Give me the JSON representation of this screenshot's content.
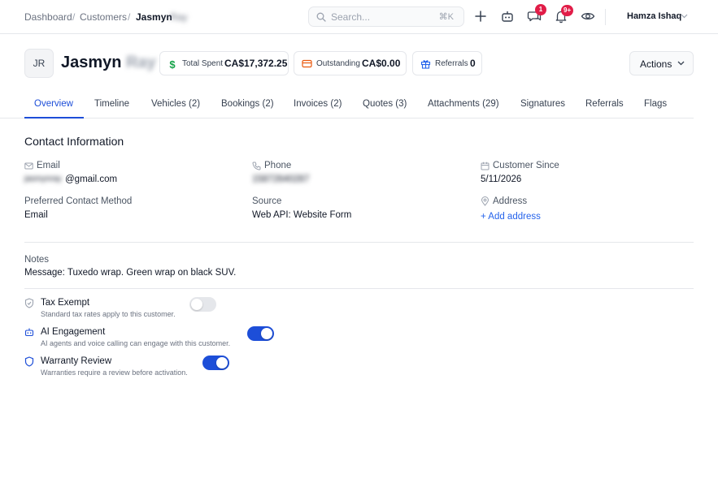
{
  "breadcrumb": {
    "dashboard": "Dashboard",
    "customers": "Customers",
    "current_first": "Jasmyn",
    "current_last": "Ray",
    "sep": "/"
  },
  "search": {
    "placeholder": "Search...",
    "shortcut": "⌘K"
  },
  "badges": {
    "messages": "1",
    "notifications": "9+"
  },
  "user": {
    "name": "Hamza Ishaq"
  },
  "customer": {
    "initials": "JR",
    "first_name": "Jasmyn",
    "last_name": "Ray"
  },
  "stats": {
    "total_spent": {
      "label": "Total Spent",
      "value": "CA$17,372.25"
    },
    "outstanding": {
      "label": "Outstanding",
      "value": "CA$0.00"
    },
    "referrals": {
      "label": "Referrals",
      "value": "0"
    }
  },
  "actions_label": "Actions",
  "tabs": [
    "Overview",
    "Timeline",
    "Vehicles (2)",
    "Bookings (2)",
    "Invoices (2)",
    "Quotes (3)",
    "Attachments (29)",
    "Signatures",
    "Referrals",
    "Flags"
  ],
  "contact": {
    "title": "Contact Information",
    "email_label": "Email",
    "email_user": "jasmynray",
    "email_domain": "@gmail.com",
    "phone_label": "Phone",
    "phone_value": "15872640287",
    "since_label": "Customer Since",
    "since_value": "5/11/2026",
    "preferred_label": "Preferred Contact Method",
    "preferred_value": "Email",
    "source_label": "Source",
    "source_value": "Web API: Website Form",
    "address_label": "Address",
    "address_link": "+ Add address"
  },
  "notes": {
    "label": "Notes",
    "value": "Message: Tuxedo wrap. Green wrap on black SUV."
  },
  "settings": {
    "tax": {
      "title": "Tax Exempt",
      "desc": "Standard tax rates apply to this customer.",
      "on": false
    },
    "ai": {
      "title": "AI Engagement",
      "desc": "AI agents and voice calling can engage with this customer.",
      "on": true
    },
    "warranty": {
      "title": "Warranty Review",
      "desc": "Warranties require a review before activation.",
      "on": true
    }
  },
  "colors": {
    "accent": "#1d4ed8",
    "badge": "#e11d48",
    "money_green": "#16a34a",
    "outstanding_orange": "#ea580c",
    "referral_blue": "#2563eb"
  }
}
